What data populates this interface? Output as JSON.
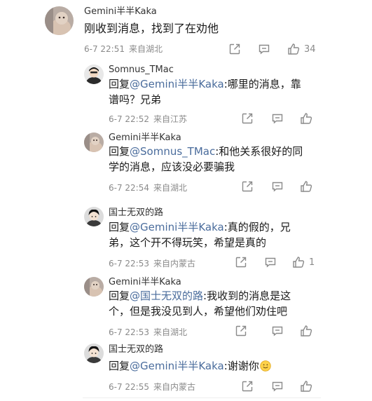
{
  "colors": {
    "mention": "#4a6c9c",
    "meta": "#8a8a8a",
    "text": "#1a1a1a"
  },
  "icons": {
    "share": "share-icon",
    "comment": "comment-icon",
    "like": "thumbs-up-icon"
  },
  "main_comment": {
    "username": "Gemini半半Kaka",
    "text": "刚收到消息，找到了在劝他",
    "time": "6-7 22:51",
    "location": "来自湖北",
    "like_count": "34"
  },
  "replies": [
    {
      "username": "Somnus_TMac",
      "reply_prefix": "回复",
      "mention": "@Gemini半半Kaka",
      "line1": ":哪里的消息，靠",
      "line2": "谱吗？兄弟",
      "time": "6-7 22:52",
      "location": "来自江苏"
    },
    {
      "username": "Gemini半半Kaka",
      "reply_prefix": "回复",
      "mention": "@Somnus_TMac",
      "line1": ":和他关系很好的同",
      "line2": "学的消息，应该没必要骗我",
      "time": "6-7 22:54",
      "location": "来自湖北"
    },
    {
      "username": "国士无双的路",
      "reply_prefix": "回复",
      "mention": "@Gemini半半Kaka",
      "line1": ":真的假的，兄",
      "line2": "弟，这个开不得玩笑，希望是真的",
      "time": "6-7 22:53",
      "location": "来自内蒙古",
      "like_count": "1"
    },
    {
      "username": "Gemini半半Kaka",
      "reply_prefix": "回复",
      "mention": "@国士无双的路",
      "line1": ":我收到的消息是这",
      "line2": "个，但是我没见到人，希望他们劝住吧",
      "time": "6-7 22:53",
      "location": "来自湖北"
    },
    {
      "username": "国士无双的路",
      "reply_prefix": "回复",
      "mention": "@Gemini半半Kaka",
      "line1": ":谢谢你",
      "emoji": "smile-emoji",
      "time": "6-7 22:55",
      "location": "来自内蒙古"
    }
  ]
}
